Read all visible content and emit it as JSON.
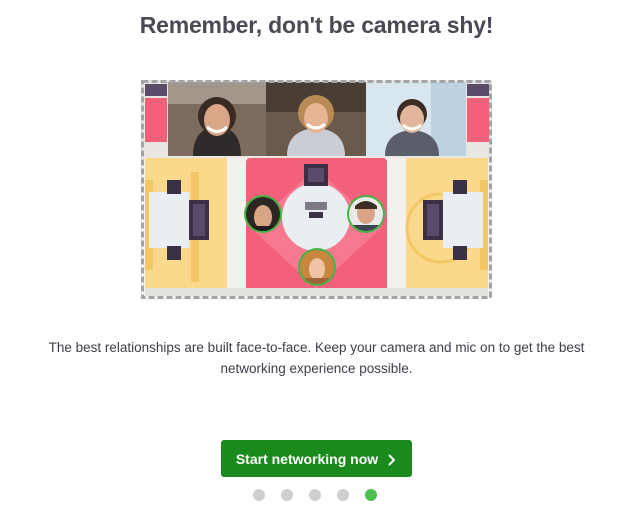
{
  "modal": {
    "title": "Remember, don't be camera shy!",
    "body": "The best relationships are built face-to-face. Keep your camera and mic on to get the best networking experience possible.",
    "cta_label": "Start networking now",
    "cta_icon": "chevron-right-icon",
    "pagination": {
      "total": 5,
      "active_index": 4
    }
  },
  "colors": {
    "cta": "#1b8a1c",
    "active_dot": "#4cbf4e",
    "inactive_dot": "#cfcfd2",
    "table_pink": "#f4607a",
    "table_yellow": "#fbd98c"
  }
}
